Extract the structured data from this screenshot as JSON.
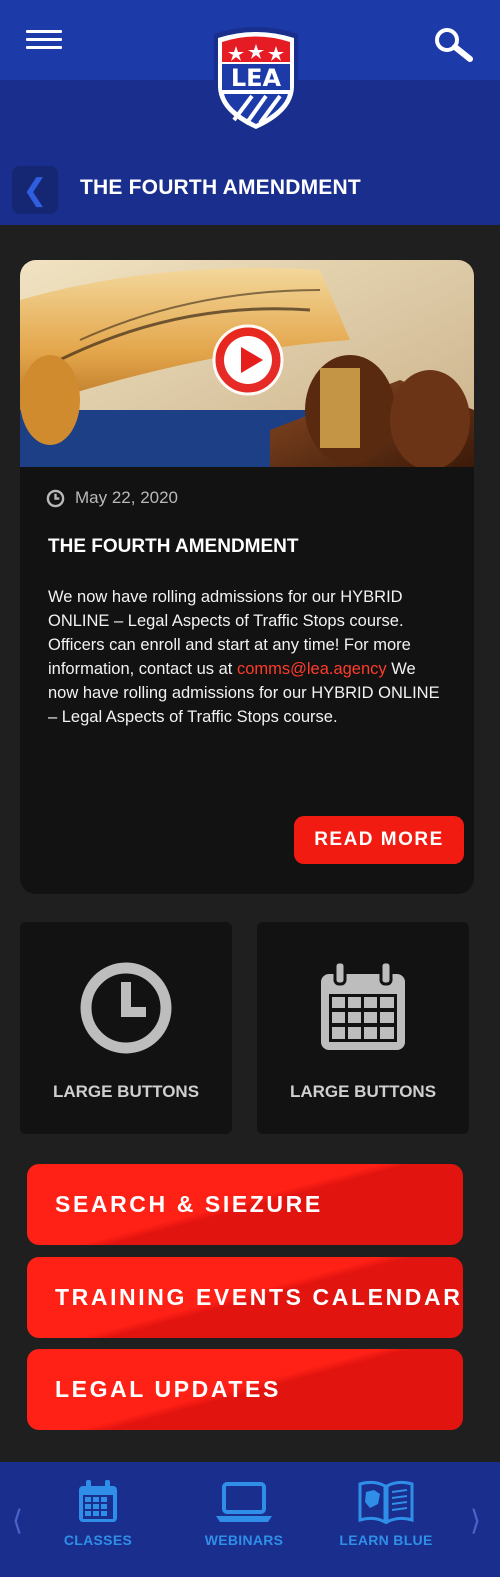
{
  "header": {
    "logo_text": "LEA",
    "page_title": "THE FOURTH AMENDMENT"
  },
  "card": {
    "date": "May 22, 2020",
    "title": "THE FOURTH AMENDMENT",
    "body_part1": "We now have rolling admissions for our HYBRID ONLINE – Legal Aspects of Traffic Stops course. Officers can enroll and start at any time! For more information, contact us at ",
    "email": "comms@lea.agency",
    "body_part2": "   We now have rolling admissions for our HYBRID ONLINE – Legal Aspects of Traffic Stops course.",
    "read_more_label": "READ MORE"
  },
  "large_buttons": [
    {
      "label": "LARGE BUTTONS",
      "icon": "clock-icon"
    },
    {
      "label": "LARGE BUTTONS",
      "icon": "calendar-icon"
    }
  ],
  "menu_buttons": [
    {
      "label": "SEARCH & SIEZURE"
    },
    {
      "label": "TRAINING EVENTS CALENDAR"
    },
    {
      "label": "LEGAL UPDATES"
    }
  ],
  "bottom_nav": {
    "items": [
      {
        "label": "CLASSES",
        "icon": "calendar-icon"
      },
      {
        "label": "WEBINARS",
        "icon": "laptop-icon"
      },
      {
        "label": "LEARN BLUE",
        "icon": "book-icon"
      }
    ]
  },
  "colors": {
    "header_blue": "#1c3aa8",
    "band_blue": "#1a2e8e",
    "accent_red": "#f21b12",
    "background": "#1f1f1f",
    "card_bg": "#121212"
  }
}
